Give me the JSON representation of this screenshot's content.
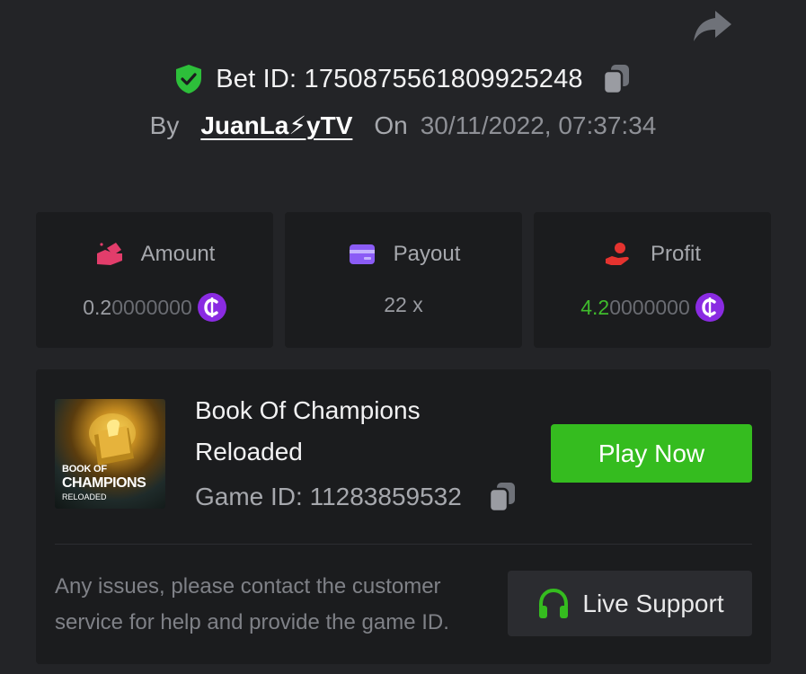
{
  "header": {
    "bet_id_label": "Bet ID: 1750875561809925248",
    "by_label": "By",
    "username": "JuanLa⚡yTV",
    "on_label": "On",
    "datetime": "30/11/2022, 07:37:34"
  },
  "stats": [
    {
      "label": "Amount",
      "value_bright": "0.2",
      "value_dim": "0000000",
      "icon": "money-hand-icon",
      "color": "#e23d6b"
    },
    {
      "label": "Payout",
      "value": "22 x",
      "icon": "wallet-card-icon",
      "color": "#8b5cf6"
    },
    {
      "label": "Profit",
      "value_bright": "4.2",
      "value_dim": "0000000",
      "icon": "profit-hand-icon",
      "color": "#e5332f"
    }
  ],
  "game": {
    "thumb_line1": "BOOK OF",
    "thumb_line2": "CHAMPIONS",
    "thumb_line3": "RELOADED",
    "name": "Book Of Champions Reloaded",
    "game_id_label": "Game ID: 11283859532",
    "play_label": "Play Now"
  },
  "support": {
    "issue_text": "Any issues, please contact the customer service for help and provide the game ID.",
    "button_label": "Live Support"
  },
  "colors": {
    "accent_green": "#35bc1f",
    "coin_purple": "#8a2be2",
    "profit_green": "#3fbb2c",
    "shield_green": "#2dbf3a"
  }
}
